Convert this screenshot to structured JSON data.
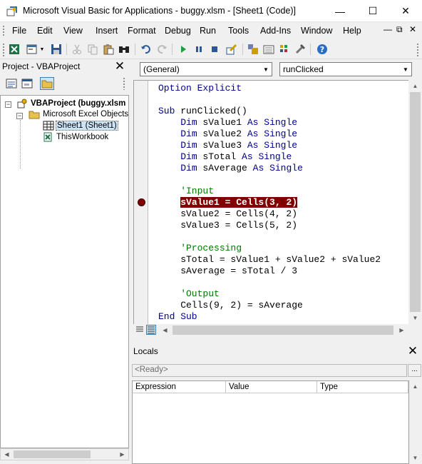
{
  "window": {
    "title": "Microsoft Visual Basic for Applications - buggy.xlsm - [Sheet1 (Code)]"
  },
  "menu": [
    "File",
    "Edit",
    "View",
    "Insert",
    "Format",
    "Debug",
    "Run",
    "Tools",
    "Add-Ins",
    "Window",
    "Help"
  ],
  "project": {
    "title": "Project - VBAProject",
    "tree": [
      {
        "label": "VBAProject (buggy.xlsm",
        "bold": true
      },
      {
        "label": "Microsoft Excel Objects"
      },
      {
        "label": "Sheet1 (Sheet1)",
        "selected": true
      },
      {
        "label": "ThisWorkbook"
      }
    ]
  },
  "code": {
    "object_combo": "(General)",
    "proc_combo": "runClicked",
    "breakpoint_line": 9,
    "lines": [
      "Option Explicit",
      "",
      "Sub runClicked()",
      "    Dim sValue1 As Single",
      "    Dim sValue2 As Single",
      "    Dim sValue3 As Single",
      "    Dim sTotal As Single",
      "    Dim sAverage As Single",
      "",
      "    'Input",
      "    sValue1 = Cells(3, 2)",
      "    sValue2 = Cells(4, 2)",
      "    sValue3 = Cells(5, 2)",
      "",
      "    'Processing",
      "    sTotal = sValue1 + sValue2 + sValue2",
      "    sAverage = sTotal / 3",
      "",
      "    'Output",
      "    Cells(9, 2) = sAverage",
      "End Sub"
    ]
  },
  "locals": {
    "title": "Locals",
    "context": "<Ready>",
    "context_button": "...",
    "columns": [
      "Expression",
      "Value",
      "Type"
    ]
  },
  "colors": {
    "keyword": "#00008b",
    "comment": "#007800",
    "breakpoint": "#800000"
  }
}
